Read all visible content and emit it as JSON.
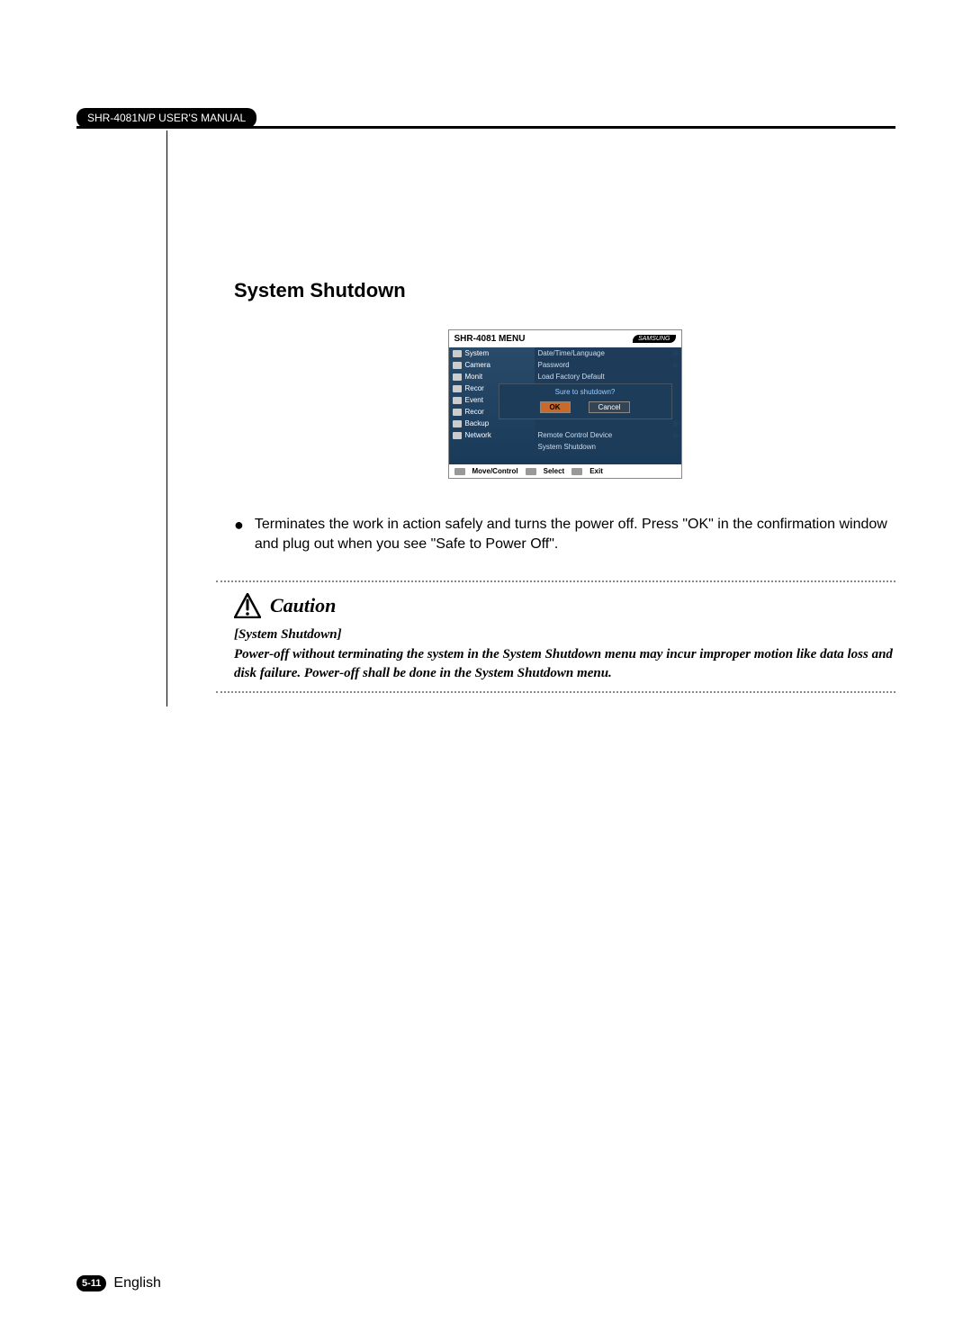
{
  "header": {
    "chip": "SHR-4081N/P USER'S MANUAL"
  },
  "section": {
    "title": "System Shutdown"
  },
  "menu": {
    "title": "SHR-4081 MENU",
    "brand": "SAMSUNG",
    "items": [
      {
        "label": "System"
      },
      {
        "label": "Camera"
      },
      {
        "label": "Monit"
      },
      {
        "label": "Recor"
      },
      {
        "label": "Event"
      },
      {
        "label": "Recor"
      },
      {
        "label": "Backup"
      },
      {
        "label": "Network"
      }
    ],
    "submenu": [
      "Date/Time/Language",
      "Password",
      "Load Factory Default",
      "Remote Control Device",
      "System Shutdown"
    ],
    "dialog": {
      "question": "Sure to shutdown?",
      "ok": "OK",
      "cancel": "Cancel"
    },
    "footer": {
      "move": "Move/Control",
      "select": "Select",
      "exit": "Exit"
    }
  },
  "body": {
    "bullet": "Terminates the work in action safely and turns the power off. Press \"OK\" in the confirmation window and plug out when you see \"Safe to Power Off\"."
  },
  "caution": {
    "label": "Caution",
    "subhead": "[System Shutdown]",
    "text": "Power-off without terminating the system in the System Shutdown menu may incur improper motion like data loss and disk failure. Power-off shall be done in the System Shutdown menu."
  },
  "footer": {
    "page": "5-11",
    "lang": "English"
  }
}
